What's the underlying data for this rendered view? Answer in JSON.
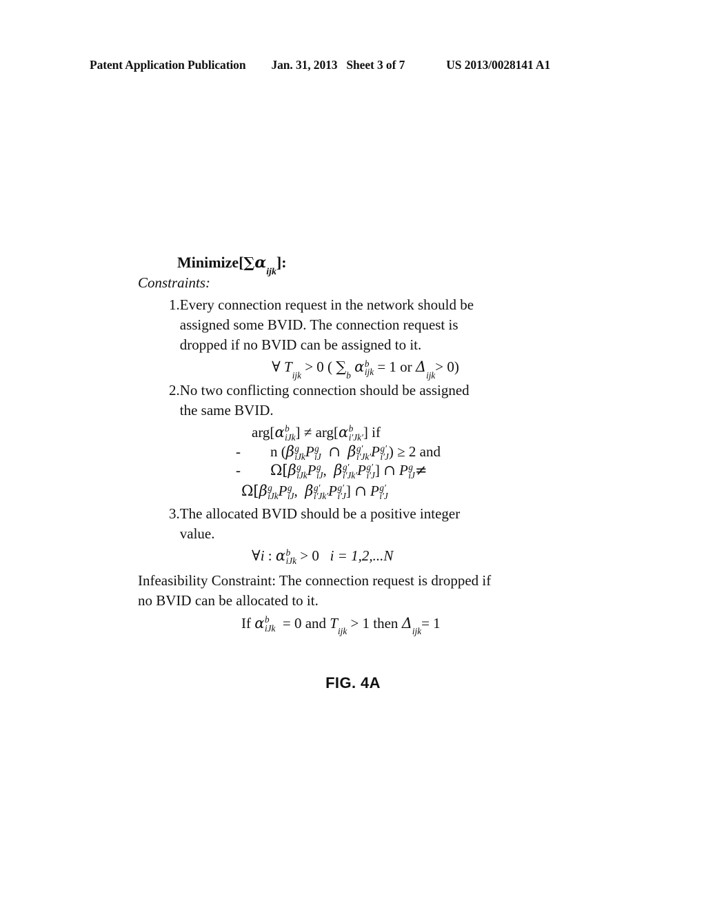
{
  "header": {
    "left": "Patent Application Publication",
    "date": "Jan. 31, 2013",
    "sheet": "Sheet 3 of 7",
    "publication_number": "US 2013/0028141 A1"
  },
  "objective": {
    "label_minimize": "Minimize",
    "bracket_open": "[",
    "sigma": "∑",
    "alpha": "α",
    "alpha_sub": "ijk",
    "bracket_close": "]:",
    "full_text": "Minimize [∑αijk]:"
  },
  "constraints_label": "Constraints:",
  "items": [
    {
      "number": "1.",
      "text_line1": "Every connection request in the network should be",
      "text_line2": "assigned some BVID. The connection request is",
      "text_line3": "dropped if no BVID can be assigned to it.",
      "full_text": "Every connection request in the network should be assigned some BVID. The connection request is dropped if no BVID can be assigned to it."
    },
    {
      "number": "2.",
      "text_line1": "No two conflicting connection should be assigned",
      "text_line2": "the same BVID.",
      "full_text": "No two conflicting connection should be assigned the same BVID."
    },
    {
      "number": "3.",
      "text_line1": "The allocated BVID should be a positive integer",
      "text_line2": "value.",
      "full_text": "The allocated BVID should be a positive integer value."
    }
  ],
  "formulas": {
    "f1": {
      "forall": "∀",
      "T": "T",
      "T_sub": "ijk",
      "gt1": "> 0 (",
      "sigma": "∑",
      "sigma_sub": "b",
      "alpha": "α",
      "alpha_sup": "b",
      "alpha_sub": "ijk",
      "eq": "= 1 or",
      "delta": "Δ",
      "delta_sub": "ijk",
      "tail": "> 0)",
      "plain": "∀ Tijk > 0 ( ∑b α^b_ijk = 1 or Δijk > 0)"
    },
    "f2": {
      "arg1": "arg[",
      "alpha": "α",
      "alpha_sup": "b",
      "alpha_sub1": "iJk",
      "mid": "] ≠ arg[",
      "alpha_sub2": "i′Jk′",
      "tail": "] if",
      "plain": "arg[α^b_iJk] ≠ arg[α^b_i′Jk′] if"
    },
    "f3": {
      "dash": "-",
      "n": "n (",
      "beta": "β",
      "beta_sup1": "g",
      "beta_sub1": "iJk",
      "P": "P",
      "P_sup1": "g",
      "P_sub1": "iJ",
      "cap": "∩",
      "beta_sup2": "g′",
      "beta_sub2": "i′Jk′",
      "P_sup2": "g′",
      "P_sub2": "i′J",
      "tail": ") ≥ 2 and",
      "plain": "n (β^g_iJk P^g_iJ ∩ β^g′_i′Jk′ P^g′_i′J) ≥ 2 and"
    },
    "f4": {
      "dash": "-",
      "omega": "Ω[",
      "beta": "β",
      "beta_sup1": "g",
      "beta_sub1": "iJk",
      "P": "P",
      "P_sup1": "g",
      "P_sub1": "iJ",
      "comma": ",",
      "beta_sup2": "g′",
      "beta_sub2": "i′Jk′",
      "P_sup2": "g′",
      "P_sub2": "i′J",
      "close": "]",
      "cap": "∩",
      "P_sup3": "g",
      "P_sub3": "iJ",
      "neq": "≠",
      "plain": "Ω[β^g_iJk P^g_iJ, β^g′_i′Jk′ P^g′_i′J] ∩ P^g_iJ ≠"
    },
    "f5": {
      "omega": "Ω[",
      "beta": "β",
      "beta_sup1": "g",
      "beta_sub1": "iJk",
      "P": "P",
      "P_sup1": "g",
      "P_sub1": "iJ",
      "comma": ",",
      "beta_sup2": "g′",
      "beta_sub2": "i′Jk′",
      "P_sup2": "g′",
      "P_sub2": "i′J",
      "close": "]",
      "cap": "∩",
      "P_sup3": "g′",
      "P_sub3": "i′J",
      "plain": "Ω[β^g_iJk P^g_iJ, β^g′_i′Jk′ P^g′_i′J] ∩ P^g′_i′J"
    },
    "f6": {
      "forall": "∀",
      "i": "i",
      "colon": ":",
      "alpha": "α",
      "alpha_sup": "b",
      "alpha_sub": "iJk",
      "gt": "> 0",
      "range": "i = 1,2,...N",
      "plain": "∀i : α^b_iJk > 0   i = 1,2,...N"
    },
    "f7": {
      "if": "If",
      "alpha": "α",
      "alpha_sup": "b",
      "alpha_sub": "iJk",
      "eq0": "= 0 and",
      "T": "T",
      "T_sub": "ijk",
      "gt1": "> 1 then",
      "delta": "Δ",
      "delta_sub": "ijk",
      "eq1": "= 1",
      "plain": "If α^b_iJk = 0 and Tijk > 1 then Δijk= 1"
    }
  },
  "infeasibility": {
    "line1": "Infeasibility Constraint: The connection request is dropped if",
    "line2": "no BVID can be allocated to it.",
    "full_text": "Infeasibility Constraint: The connection request is dropped if no BVID can be allocated to it."
  },
  "figure_caption": "FIG. 4A"
}
